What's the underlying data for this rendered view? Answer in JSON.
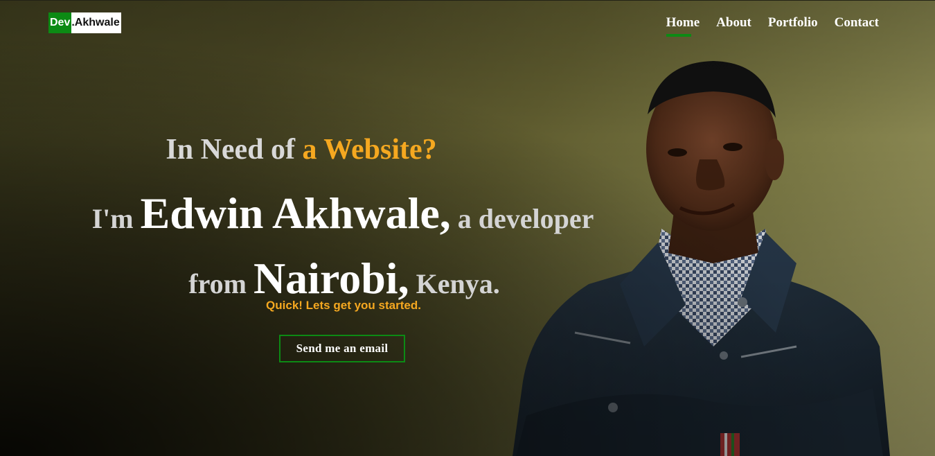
{
  "logo": {
    "part1": "Dev",
    "part2": ".Akhwale"
  },
  "nav": {
    "items": [
      {
        "label": "Home",
        "active": true
      },
      {
        "label": "About",
        "active": false
      },
      {
        "label": "Portfolio",
        "active": false
      },
      {
        "label": "Contact",
        "active": false
      }
    ]
  },
  "hero": {
    "headline_prefix": "In Need of ",
    "headline_accent": "a Website?",
    "intro_im": "I'm ",
    "intro_name": "Edwin Akhwale,",
    "intro_role": " a developer",
    "intro_from": "from ",
    "intro_city": "Nairobi,",
    "intro_country": " Kenya.",
    "tagline": "Quick! Lets get you started.",
    "cta_label": "Send me an email"
  },
  "colors": {
    "brand_green": "#0c8a14",
    "accent_orange": "#f5a820",
    "text_light": "#d8d8d8",
    "white": "#ffffff"
  },
  "icons": {
    "portrait": "person-portrait"
  }
}
